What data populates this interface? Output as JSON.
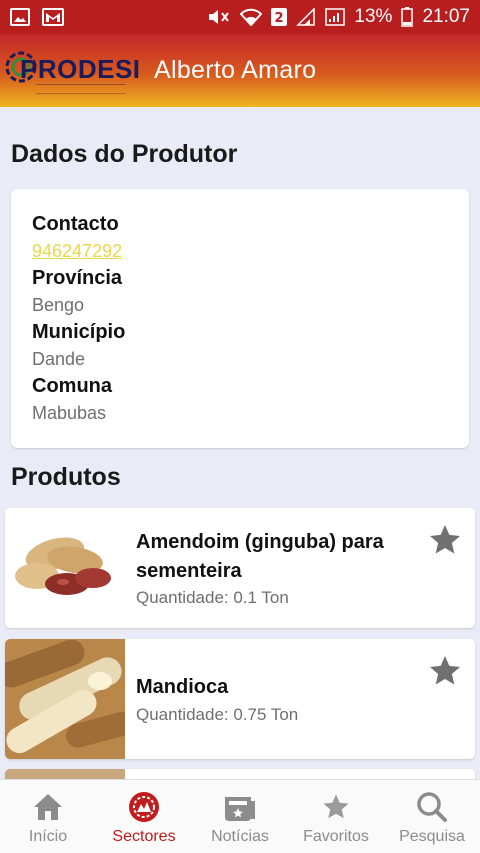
{
  "status_bar": {
    "battery": "13%",
    "time": "21:07",
    "sim_badge": "2"
  },
  "header": {
    "logo_text": "PRODESI",
    "title": "Alberto Amaro"
  },
  "producer": {
    "section_title": "Dados do Produtor",
    "contact_label": "Contacto",
    "contact_value": "946247292",
    "province_label": "Província",
    "province_value": "Bengo",
    "municipality_label": "Município",
    "municipality_value": "Dande",
    "commune_label": "Comuna",
    "commune_value": "Mabubas"
  },
  "products": {
    "section_title": "Produtos",
    "items": [
      {
        "name": "Amendoim (ginguba) para sementeira",
        "quantity": "Quantidade: 0.1 Ton",
        "image": "peanuts"
      },
      {
        "name": "Mandioca",
        "quantity": "Quantidade: 0.75 Ton",
        "image": "cassava"
      }
    ]
  },
  "nav": {
    "items": [
      {
        "label": "Início",
        "icon": "home-icon"
      },
      {
        "label": "Sectores",
        "icon": "sectors-icon"
      },
      {
        "label": "Notícias",
        "icon": "news-icon"
      },
      {
        "label": "Favoritos",
        "icon": "star-icon"
      },
      {
        "label": "Pesquisa",
        "icon": "search-icon"
      }
    ],
    "active": "Sectores"
  },
  "colors": {
    "status_bar": "#b81e1e",
    "accent": "#c01c1c",
    "link": "#e8d84a",
    "background": "#e9ecf6"
  }
}
